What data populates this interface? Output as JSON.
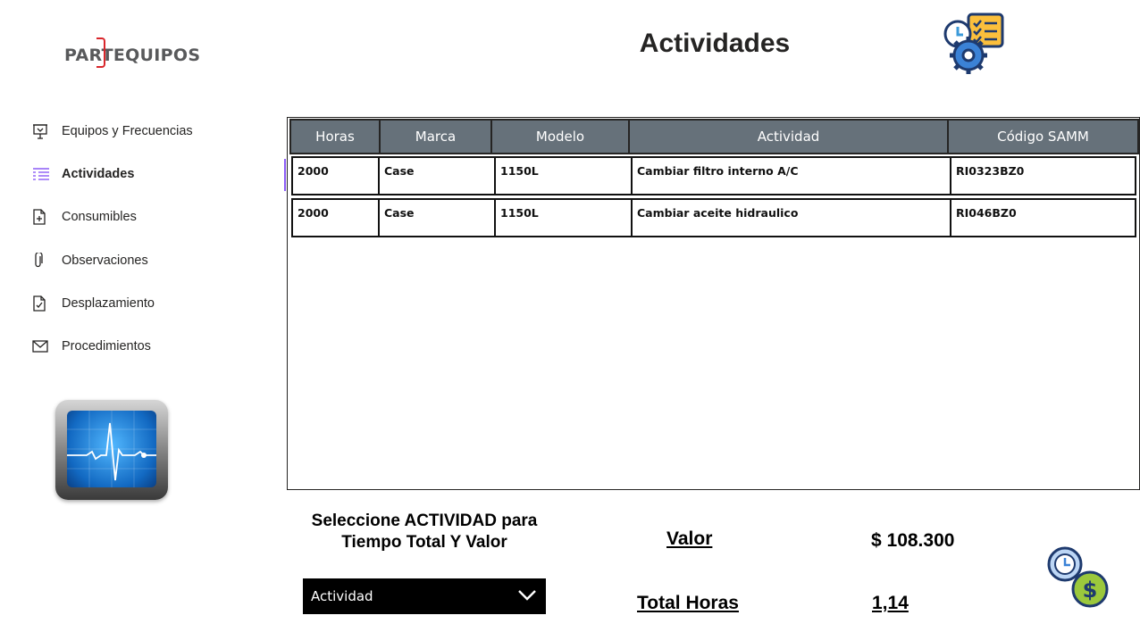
{
  "brand": {
    "logo_text": "PARTEQUIPOS",
    "accent": "#d9262b"
  },
  "header": {
    "title": "Actividades"
  },
  "nav": {
    "items": [
      {
        "label": "Equipos y Frecuencias",
        "icon": "presentation-board-icon"
      },
      {
        "label": "Actividades",
        "icon": "list-icon",
        "active": true
      },
      {
        "label": "Consumibles",
        "icon": "document-add-icon"
      },
      {
        "label": "Observaciones",
        "icon": "paperclip-icon"
      },
      {
        "label": "Desplazamiento",
        "icon": "document-check-icon"
      },
      {
        "label": "Procedimientos",
        "icon": "mail-icon"
      }
    ],
    "active_color": "#8b5cf6"
  },
  "table": {
    "header_bg": "#66717a",
    "columns": [
      "Horas",
      "Marca",
      "Modelo",
      "Actividad",
      "Código SAMM"
    ],
    "rows": [
      [
        "2000",
        "Case",
        "1150L",
        "Cambiar filtro interno A/C",
        "RI0323BZ0"
      ],
      [
        "2000",
        "Case",
        "1150L",
        "Cambiar aceite hidraulico",
        "RI046BZ0"
      ]
    ]
  },
  "selector": {
    "caption_line1": "Seleccione ACTIVIDAD para",
    "caption_line2": "Tiempo Total Y Valor",
    "dropdown_value": "Actividad"
  },
  "summary": {
    "valor_label": "Valor",
    "valor_value": "$ 108.300",
    "horas_label": "Total Horas",
    "horas_value": "1,14"
  }
}
